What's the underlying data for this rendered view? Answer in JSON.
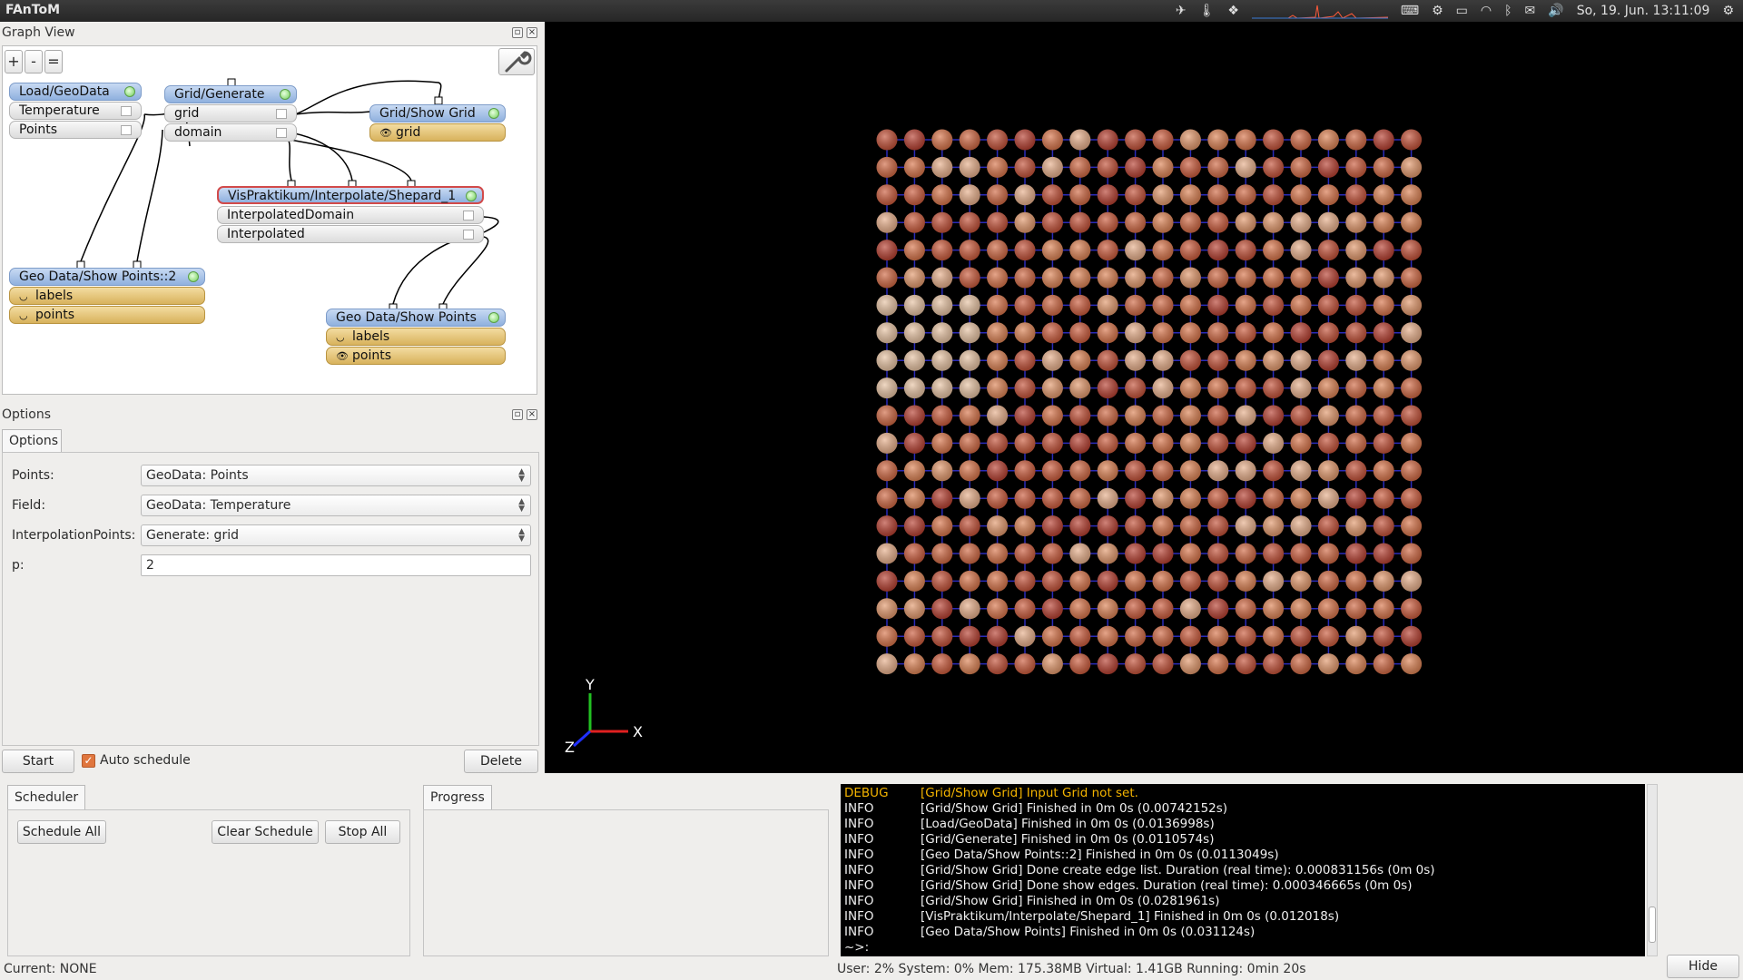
{
  "app": {
    "title": "FAnToM"
  },
  "tray": {
    "clock": "So, 19. Jun. 13:11:09"
  },
  "graph_view": {
    "title": "Graph View",
    "zoom_in": "+",
    "zoom_out": "-",
    "zoom_reset": "=",
    "nodes": {
      "load": {
        "title": "Load/GeoData",
        "ports": [
          "Temperature",
          "Points"
        ]
      },
      "generate": {
        "title": "Grid/Generate",
        "ports": [
          "grid",
          "domain"
        ]
      },
      "show_grid": {
        "title": "Grid/Show Grid",
        "outputs": [
          "grid"
        ]
      },
      "shepard": {
        "title": "VisPraktikum/Interpolate/Shepard_1",
        "ports": [
          "InterpolatedDomain",
          "Interpolated"
        ]
      },
      "show_points2": {
        "title": "Geo Data/Show Points::2",
        "outputs": [
          "labels",
          "points"
        ]
      },
      "show_points": {
        "title": "Geo Data/Show Points",
        "outputs": [
          "labels",
          "points"
        ]
      }
    }
  },
  "options": {
    "title": "Options",
    "tab": "Options",
    "fields": [
      {
        "label": "Points:",
        "value": "GeoData: Points"
      },
      {
        "label": "Field:",
        "value": "GeoData: Temperature"
      },
      {
        "label": "InterpolationPoints:",
        "value": "Generate: grid"
      },
      {
        "label": "p:",
        "value": "2"
      }
    ],
    "start": "Start",
    "auto_schedule": "Auto schedule",
    "delete": "Delete"
  },
  "viewport": {
    "axes": {
      "x": "X",
      "y": "Y",
      "z": "Z"
    }
  },
  "scheduler": {
    "tab": "Scheduler",
    "schedule_all": "Schedule All",
    "clear_schedule": "Clear Schedule",
    "stop_all": "Stop All"
  },
  "progress": {
    "tab": "Progress"
  },
  "log": [
    {
      "level": "DEBUG",
      "msg": "[Grid/Show Grid] Input Grid not set."
    },
    {
      "level": "INFO",
      "msg": "[Grid/Show Grid] Finished in 0m 0s (0.00742152s)"
    },
    {
      "level": "INFO",
      "msg": "[Load/GeoData] Finished in 0m 0s (0.0136998s)"
    },
    {
      "level": "INFO",
      "msg": "[Grid/Generate] Finished in 0m 0s (0.0110574s)"
    },
    {
      "level": "INFO",
      "msg": "[Geo Data/Show Points::2] Finished in 0m 0s (0.0113049s)"
    },
    {
      "level": "INFO",
      "msg": "[Grid/Show Grid] Done create edge list. Duration (real time): 0.000831156s (0m 0s)"
    },
    {
      "level": "INFO",
      "msg": "[Grid/Show Grid] Done show edges. Duration (real time): 0.000346665s (0m 0s)"
    },
    {
      "level": "INFO",
      "msg": "[Grid/Show Grid] Finished in 0m 0s (0.0281961s)"
    },
    {
      "level": "INFO",
      "msg": "[VisPraktikum/Interpolate/Shepard_1] Finished in 0m 0s (0.012018s)"
    },
    {
      "level": "INFO",
      "msg": "[Geo Data/Show Points] Finished in 0m 0s (0.031124s)"
    }
  ],
  "log_prompt": "~>:",
  "status": {
    "current": "Current: NONE",
    "stats": "User: 2% System: 0%  Mem: 175.38MB Virtual: 1.41GB Running: 0min 20s",
    "hide": "Hide"
  }
}
